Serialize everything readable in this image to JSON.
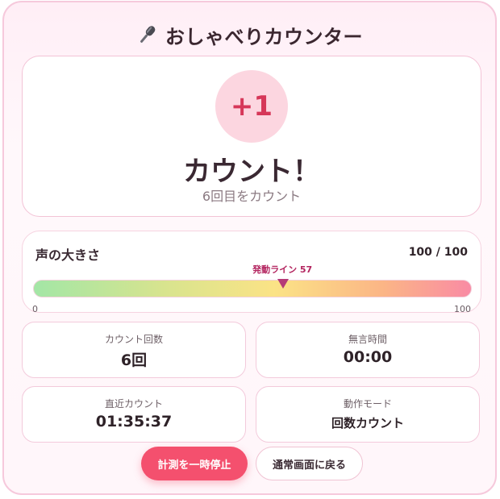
{
  "header": {
    "title": "おしゃべりカウンター",
    "icon": "microphone-icon"
  },
  "count_card": {
    "increment": "+1",
    "title": "カウント！",
    "subtitle": "6回目をカウント"
  },
  "volume": {
    "label": "声の大きさ",
    "value_text": "100 / 100",
    "level": 100,
    "threshold_label": "発動ライン 57",
    "threshold": 57,
    "min_label": "0",
    "max_label": "100"
  },
  "stats": {
    "count": {
      "label": "カウント回数",
      "value": "6回"
    },
    "silence": {
      "label": "無言時間",
      "value": "00:00"
    },
    "recent": {
      "label": "直近カウント",
      "value": "01:35:37"
    },
    "mode": {
      "label": "動作モード",
      "value": "回数カウント"
    }
  },
  "buttons": {
    "pause": "計測を一時停止",
    "back": "通常画面に戻る"
  },
  "colors": {
    "accent": "#f4506e",
    "increment_bg": "#fcd6e0",
    "increment_text": "#d63759",
    "threshold_marker": "#b53a77"
  }
}
